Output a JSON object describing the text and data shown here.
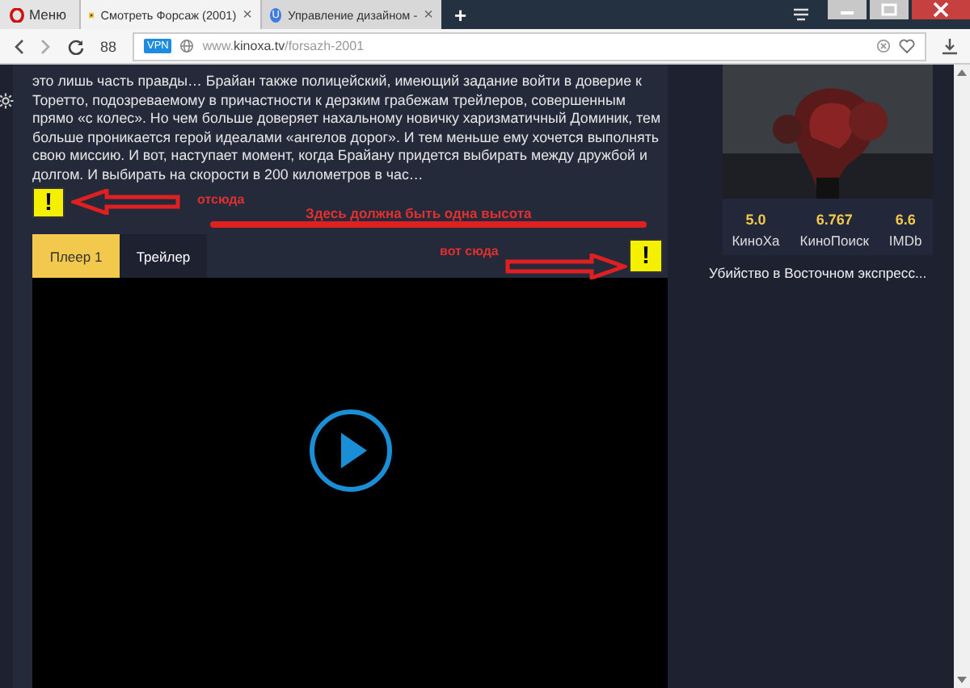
{
  "browser": {
    "menu_label": "Меню",
    "tabs": [
      {
        "title": "Смотреть Форсаж (2001)",
        "selected": true,
        "close": "×"
      },
      {
        "title": "Управление дизайном -",
        "selected": false,
        "badge": "U",
        "close": "×"
      }
    ],
    "new_tab": "+",
    "speed_dial": "88",
    "vpn": "VPN",
    "url": "www.**kinoxa.tv**/forsazh-2001"
  },
  "description": "это лишь часть правды… Брайан также полицейский, имеющий задание войти в доверие к Торетто, подозреваемому в причастности к дерзким грабежам трейлеров, совершенным прямо «с колес». Но чем больше доверяет нахальному новичку харизматичный Доминик, тем больше проникается герой идеалами «ангелов дорог». И тем меньше ему хочется выполнять свою миссию. И вот, наступает момент, когда Брайану придется выбирать между дружбой и долгом. И выбирать на скорости в 200 километров в час…",
  "player_tabs": [
    {
      "label": "Плеер 1",
      "selected": true
    },
    {
      "label": "Трейлер",
      "selected": false
    }
  ],
  "annotations": {
    "from": "отсюда",
    "note": "Здесь должна быть одна высота",
    "to": "вот сюда",
    "markers": [
      "!",
      "!"
    ]
  },
  "sidebar": {
    "ratings": [
      {
        "value": "5.0",
        "source": "КиноХа"
      },
      {
        "value": "6.767",
        "source": "КиноПоиск"
      },
      {
        "value": "6.6",
        "source": "IMDb"
      }
    ],
    "title": "Убийство в Восточном экспресс..."
  }
}
